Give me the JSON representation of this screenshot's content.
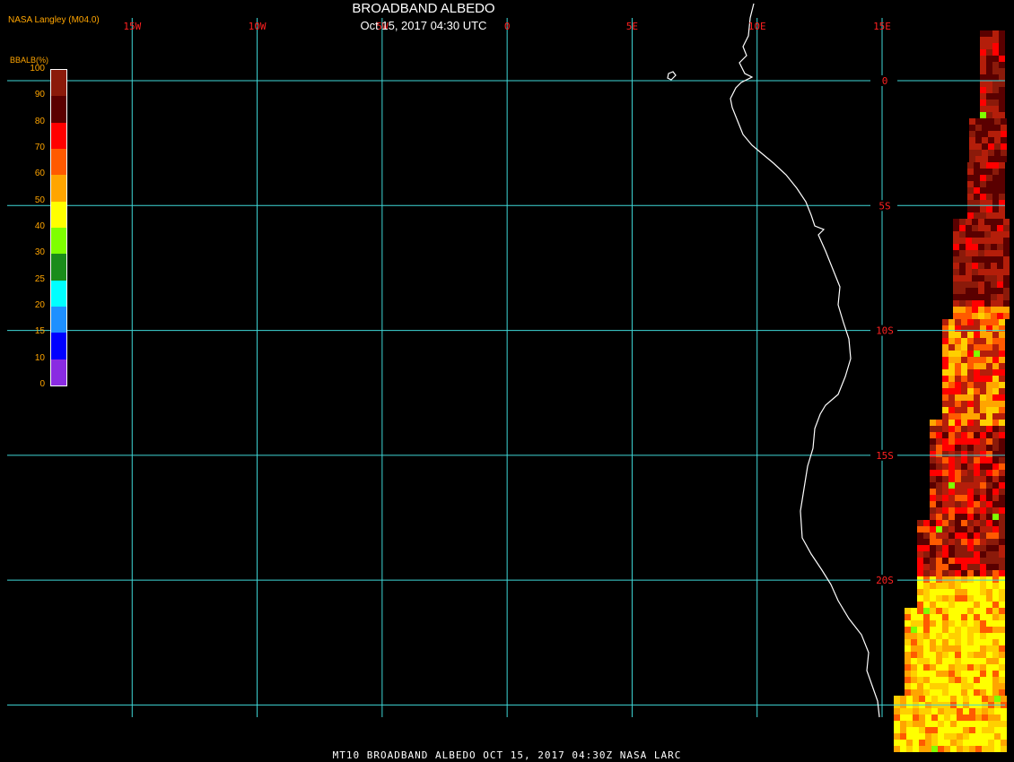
{
  "title": "BROADBAND ALBEDO",
  "subtitle": "Oct 15, 2017 04:30 UTC",
  "source": "NASA Langley (M04.0)",
  "footer": "MT10  BROADBAND ALBEDO   OCT 15, 2017 04:30Z   NASA LARC",
  "legend": {
    "label": "BBALB(%)",
    "ticks": [
      "100",
      "90",
      "80",
      "70",
      "60",
      "50",
      "40",
      "30",
      "25",
      "20",
      "15",
      "10",
      "0"
    ],
    "colors": [
      "#8b1a0a",
      "#5a0000",
      "#ff0000",
      "#ff5a00",
      "#ffa500",
      "#ffff00",
      "#7fff00",
      "#1a8c1a",
      "#00ffff",
      "#1e90ff",
      "#0000ff",
      "#8a2be2"
    ]
  },
  "map": {
    "lon_labels": [
      "15W",
      "10W",
      "5W",
      "0",
      "5E",
      "10E",
      "15E"
    ],
    "lat_labels": [
      "0",
      "5S",
      "10S",
      "15S",
      "20S"
    ],
    "lon_range": [
      -20,
      15
    ],
    "lat_range": [
      2,
      -25
    ],
    "grid_color": "#3fd7d7",
    "label_color": "#ff2020",
    "coastline_color": "#ffffff"
  }
}
